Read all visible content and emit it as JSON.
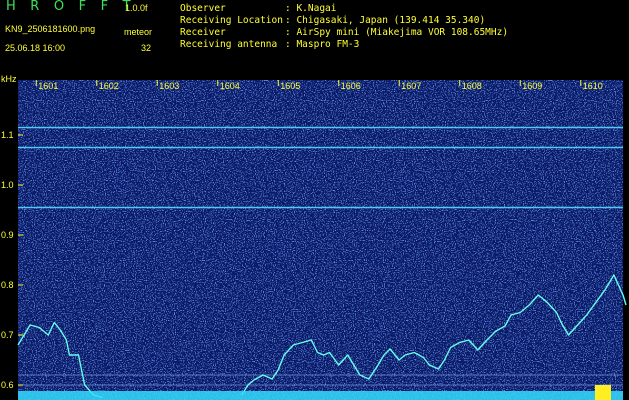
{
  "header": {
    "title": "H R O F F T",
    "version": "1.0.0f",
    "filename": "KN9_2506181600.png",
    "meteor_label": "meteor",
    "datetime": "25.06.18 16:00",
    "meteor_count": "32",
    "info": [
      {
        "key": "Observer",
        "value": ": K.Nagai"
      },
      {
        "key": "Receiving Location",
        "value": ": Chigasaki, Japan (139.414 35.340)"
      },
      {
        "key": "Receiver",
        "value": ": AirSpy mini (Miakejima VOR 108.65MHz)"
      },
      {
        "key": "Receiving antenna",
        "value": ": Maspro FM-3"
      }
    ]
  },
  "colors": {
    "background": "#000000",
    "spectrogram_bg": "#0a1a66",
    "noise": "#2244bb",
    "signal": "#66ffee",
    "label": "#ffff33",
    "title": "#3ee05a"
  },
  "chart_data": {
    "type": "heatmap",
    "ylabel": "kHz",
    "x_ticks": [
      "1601",
      "1602",
      "1603",
      "1604",
      "1605",
      "1606",
      "1607",
      "1608",
      "1609",
      "1610"
    ],
    "y_ticks": [
      0.6,
      0.7,
      0.8,
      0.9,
      1.0,
      1.1
    ],
    "ylim": [
      0.57,
      1.21
    ],
    "xlim": [
      0,
      10
    ],
    "horizontal_lines_khz": [
      1.115,
      1.075,
      0.955,
      0.62,
      0.6
    ],
    "trace": [
      [
        0.0,
        0.68
      ],
      [
        0.2,
        0.72
      ],
      [
        0.35,
        0.715
      ],
      [
        0.5,
        0.7
      ],
      [
        0.6,
        0.725
      ],
      [
        0.7,
        0.71
      ],
      [
        0.8,
        0.69
      ],
      [
        0.85,
        0.66
      ],
      [
        1.0,
        0.66
      ],
      [
        1.1,
        0.6
      ],
      [
        1.25,
        0.58
      ],
      [
        1.4,
        0.575
      ]
    ],
    "trace2": [
      [
        3.7,
        0.58
      ],
      [
        3.8,
        0.6
      ],
      [
        3.9,
        0.61
      ],
      [
        4.05,
        0.62
      ],
      [
        4.2,
        0.612
      ],
      [
        4.3,
        0.63
      ],
      [
        4.4,
        0.66
      ],
      [
        4.55,
        0.68
      ],
      [
        4.7,
        0.685
      ],
      [
        4.85,
        0.69
      ],
      [
        4.95,
        0.665
      ],
      [
        5.05,
        0.66
      ],
      [
        5.15,
        0.665
      ],
      [
        5.3,
        0.64
      ],
      [
        5.45,
        0.66
      ],
      [
        5.55,
        0.64
      ],
      [
        5.65,
        0.62
      ],
      [
        5.8,
        0.612
      ],
      [
        5.95,
        0.64
      ],
      [
        6.05,
        0.66
      ],
      [
        6.15,
        0.672
      ],
      [
        6.3,
        0.65
      ],
      [
        6.4,
        0.66
      ],
      [
        6.55,
        0.665
      ],
      [
        6.7,
        0.655
      ],
      [
        6.8,
        0.64
      ],
      [
        6.95,
        0.632
      ],
      [
        7.05,
        0.65
      ],
      [
        7.15,
        0.675
      ],
      [
        7.3,
        0.685
      ],
      [
        7.45,
        0.69
      ],
      [
        7.6,
        0.67
      ],
      [
        7.75,
        0.69
      ],
      [
        7.9,
        0.708
      ],
      [
        8.05,
        0.718
      ],
      [
        8.15,
        0.74
      ],
      [
        8.3,
        0.745
      ],
      [
        8.45,
        0.76
      ],
      [
        8.6,
        0.78
      ],
      [
        8.75,
        0.765
      ],
      [
        8.9,
        0.745
      ],
      [
        9.0,
        0.72
      ],
      [
        9.1,
        0.7
      ],
      [
        9.25,
        0.72
      ],
      [
        9.4,
        0.74
      ],
      [
        9.55,
        0.765
      ],
      [
        9.7,
        0.79
      ],
      [
        9.85,
        0.82
      ],
      [
        10.0,
        0.78
      ],
      [
        10.05,
        0.76
      ]
    ]
  }
}
